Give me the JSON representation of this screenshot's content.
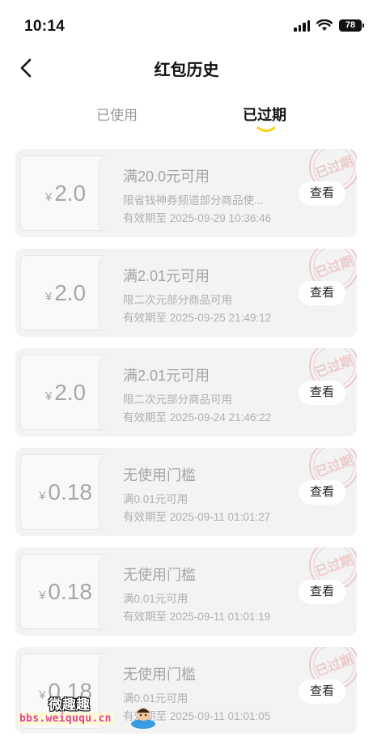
{
  "status_bar": {
    "time": "10:14",
    "battery": "78"
  },
  "nav": {
    "title": "红包历史"
  },
  "tabs": [
    {
      "label": "已使用",
      "active": false
    },
    {
      "label": "已过期",
      "active": true
    }
  ],
  "stamp_text": "已过期",
  "coupons": [
    {
      "currency": "¥",
      "amount": "2.0",
      "title": "满20.0元可用",
      "desc": "限省钱神券频道部分商品使...",
      "expiry": "有效期至  2025-09-29 10:36:46",
      "button": "查看"
    },
    {
      "currency": "¥",
      "amount": "2.0",
      "title": "满2.01元可用",
      "desc": "限二次元部分商品可用",
      "expiry": "有效期至  2025-09-25 21:49:12",
      "button": "查看"
    },
    {
      "currency": "¥",
      "amount": "2.0",
      "title": "满2.01元可用",
      "desc": "限二次元部分商品可用",
      "expiry": "有效期至  2025-09-24 21:46:22",
      "button": "查看"
    },
    {
      "currency": "¥",
      "amount": "0.18",
      "title": "无使用门槛",
      "desc": "满0.01元可用",
      "expiry": "有效期至  2025-09-11 01:01:27",
      "button": "查看"
    },
    {
      "currency": "¥",
      "amount": "0.18",
      "title": "无使用门槛",
      "desc": "满0.01元可用",
      "expiry": "有效期至  2025-09-11 01:01:19",
      "button": "查看"
    },
    {
      "currency": "¥",
      "amount": "0.18",
      "title": "无使用门槛",
      "desc": "满0.01元可用",
      "expiry": "有效期至  2025-09-11 01:01:05",
      "button": "查看"
    }
  ],
  "watermark": {
    "title": "微趣趣",
    "url": "bbs.weiququ.cn"
  },
  "colors": {
    "accent": "#ffd21e",
    "stamp": "#e8a8a8",
    "watermark_url": "#e0468f"
  }
}
